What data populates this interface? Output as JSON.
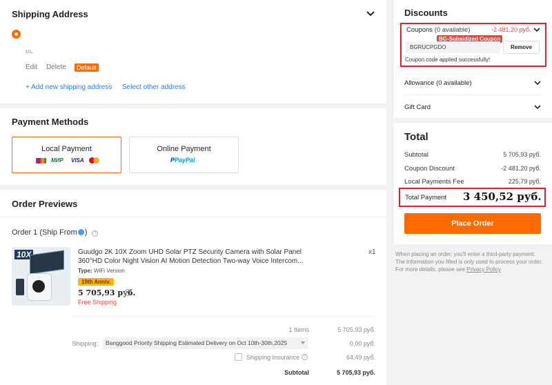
{
  "shipping": {
    "title": "Shipping Address",
    "name_partial": "BL",
    "edit": "Edit",
    "delete": "Delete",
    "default_badge": "Default",
    "add_new": "+ Add new shipping address",
    "select_other": "Select other address"
  },
  "payment": {
    "title": "Payment Methods",
    "local": {
      "label": "Local Payment",
      "icons": [
        "sbp-logo",
        "mir-logo",
        "visa-logo",
        "mastercard-logo"
      ],
      "visa": "VISA",
      "mir": "МИР"
    },
    "online": {
      "label": "Online Payment",
      "paypal": "PayPal"
    }
  },
  "order": {
    "title": "Order Previews",
    "order_label": "Order 1  (Ship From",
    "order_suffix": ")",
    "product": {
      "title": "Guudgo 2K 10X Zoom UHD Solar PTZ Security Camera with Solar Panel 360°HD Color Night Vision AI Motion Detection Two-way Voice Intercom...",
      "type_label": "Type:",
      "type_value": "WiFi Version",
      "badge": "19th Anniv.",
      "price": "5 705,93 руб.",
      "free_shipping": "Free Shipping",
      "qty": "x1",
      "image_text": "10X"
    },
    "summary": {
      "items_label": "1 Items",
      "items_value": "5 705,93 руб.",
      "shipping_label": "Shipping:",
      "shipping_method": "Banggood Priority Shipping Estimated Delivery on Oct 10th-30th,2025",
      "shipping_value": "0,00 руб.",
      "insurance_label": "Shipping Insurance",
      "insurance_value": "64,49 руб.",
      "subtotal_label": "Subtotal",
      "subtotal_value": "5 705,93 руб."
    }
  },
  "discounts": {
    "title": "Discounts",
    "coupons_label": "Coupons",
    "coupons_available": "(0 available)",
    "coupons_amount": "-2 481,20 руб.",
    "coupon_badge": "BG-Subsidized Coupon",
    "coupon_code": "BGRUCPGDO",
    "remove": "Remove",
    "success_msg": "Coupon code applied successfully!",
    "allowance": "Allowance (0 available)",
    "gift_card": "Gift Card"
  },
  "total": {
    "title": "Total",
    "rows": [
      {
        "label": "Subtotal",
        "value": "5 705,93 руб."
      },
      {
        "label": "Coupon Discount",
        "value": "-2 481,20 руб."
      },
      {
        "label": "Local Payments Fee",
        "value": "225,79 руб."
      }
    ],
    "total_payment_label": "Total Payment",
    "total_payment_value": "3 450,52 руб.",
    "place_order": "Place Order",
    "note": "When placing an order, you'll enter a third-party payment. The information you filled is only used to process your order. For more details, please see",
    "privacy_link": "Privacy Policy"
  },
  "colors": {
    "accent": "#ff6a00",
    "highlight_box": "#e0212b",
    "link": "#2d7be5"
  }
}
